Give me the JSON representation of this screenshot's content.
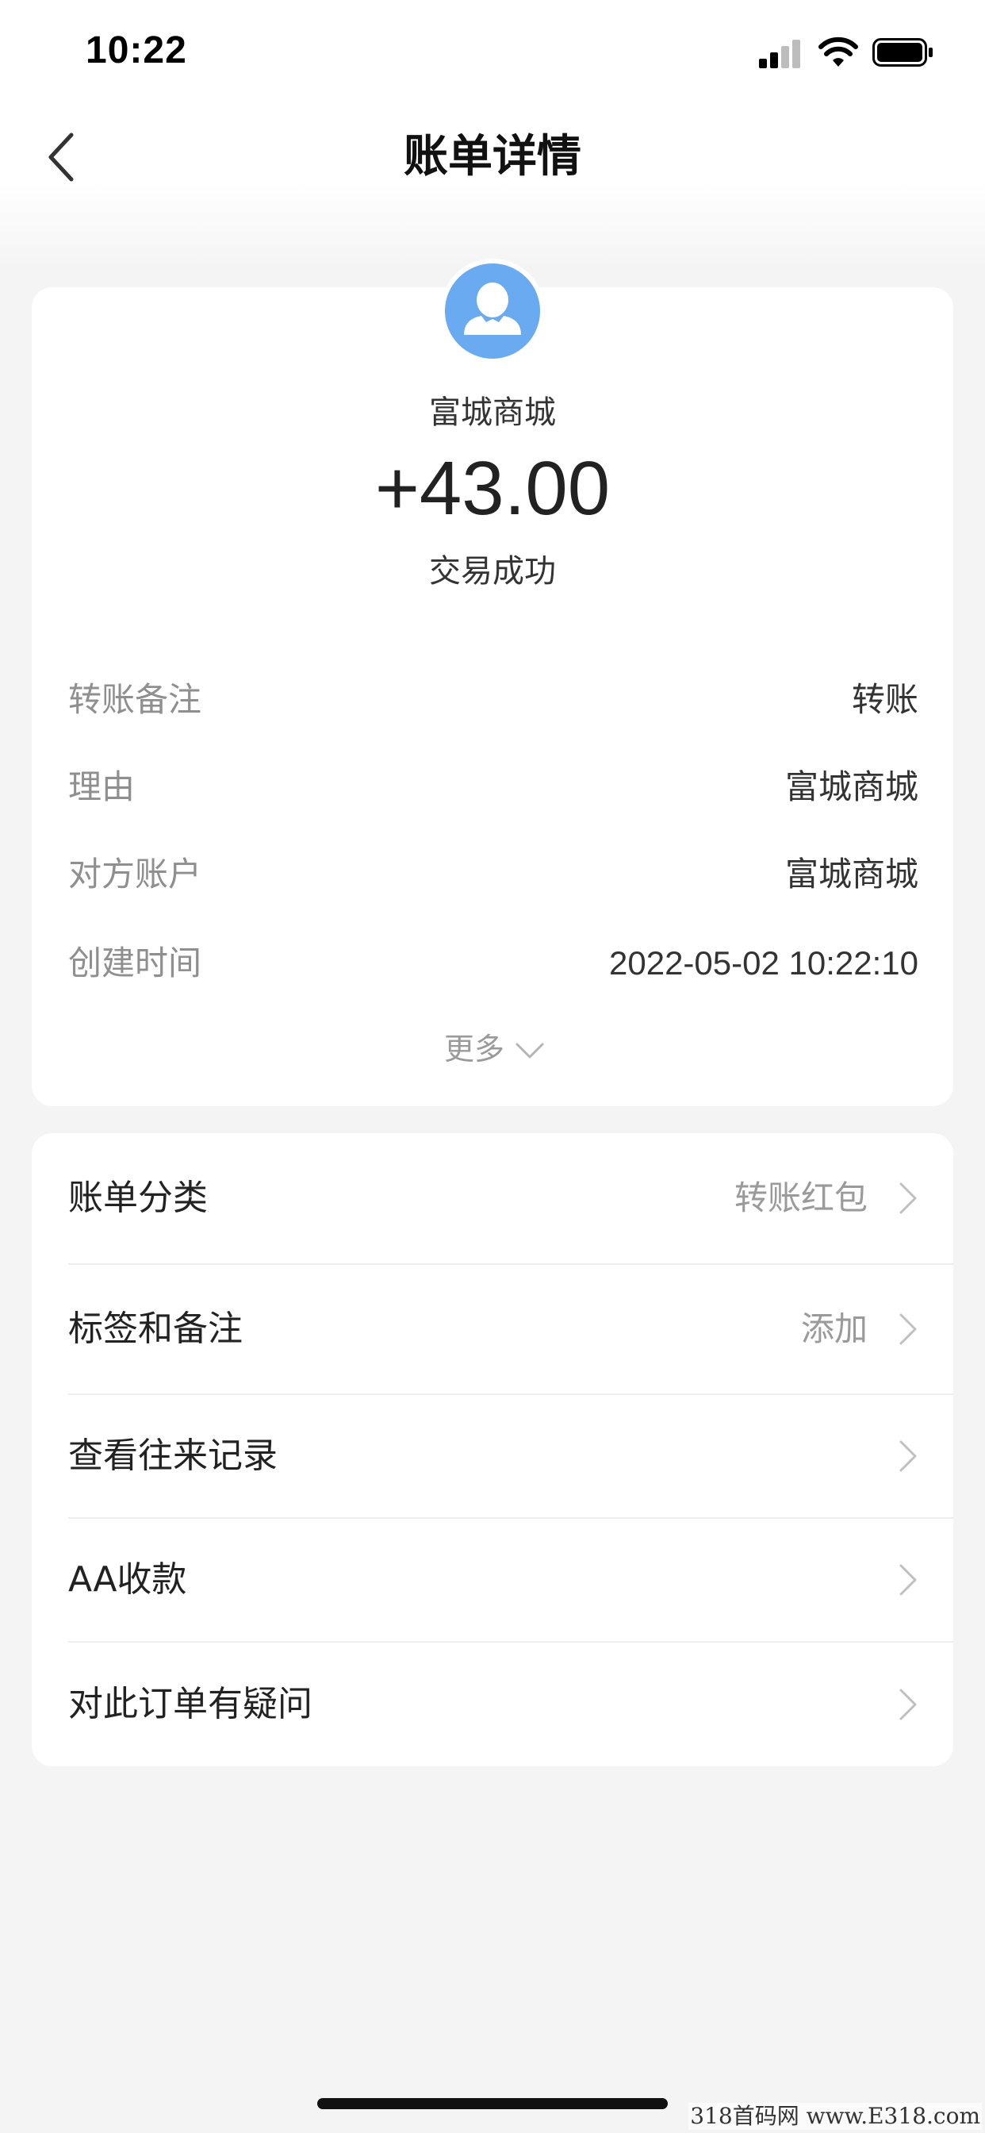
{
  "status_bar": {
    "time": "10:22",
    "signal_icon": "cellular-signal-icon",
    "wifi_icon": "wifi-icon",
    "battery_icon": "battery-full-icon"
  },
  "nav": {
    "back_icon": "chevron-left-icon",
    "title": "账单详情"
  },
  "summary": {
    "avatar_icon": "user-avatar-icon",
    "avatar_color": "#6aaaf0",
    "merchant": "富城商城",
    "amount": "+43.00",
    "status": "交易成功"
  },
  "details": [
    {
      "label": "转账备注",
      "value": "转账"
    },
    {
      "label": "理由",
      "value": "富城商城"
    },
    {
      "label": "对方账户",
      "value": "富城商城"
    },
    {
      "label": "创建时间",
      "value": "2022-05-02 10:22:10"
    }
  ],
  "more": {
    "label": "更多",
    "icon": "chevron-down-icon"
  },
  "actions": [
    {
      "label": "账单分类",
      "value": "转账红包"
    },
    {
      "label": "标签和备注",
      "value": "添加"
    },
    {
      "label": "查看往来记录",
      "value": ""
    },
    {
      "label": "AA收款",
      "value": ""
    },
    {
      "label": "对此订单有疑问",
      "value": ""
    }
  ],
  "watermark": "318首码网 www.E318.com"
}
